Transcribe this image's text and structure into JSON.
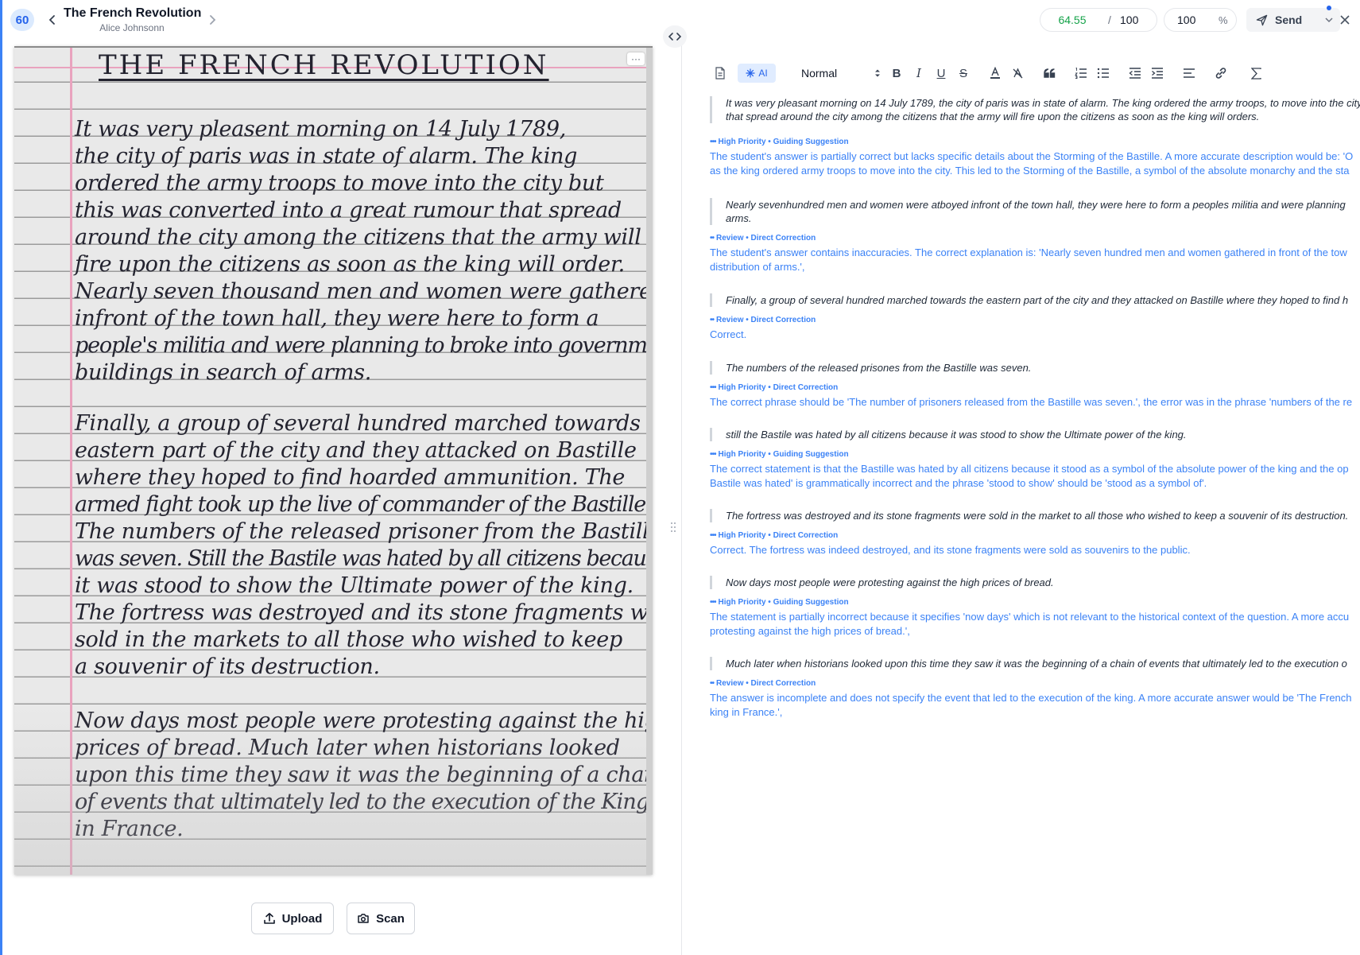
{
  "header": {
    "score_badge": "60",
    "title": "The French Revolution",
    "author": "Alice Johnsonn",
    "score_value": "64.55",
    "score_separator": "/",
    "score_max": "100",
    "percent_value": "100",
    "percent_sign": "%",
    "send_label": "Send"
  },
  "toolbar": {
    "ai_label": "AI",
    "text_style": "Normal"
  },
  "image_panel": {
    "title": "THE FRENCH REVOLUTION",
    "lines": [
      "It was very pleasent morning on 14 July 1789,",
      "the city of paris was in state of alarm. The king",
      "ordered the army troops to move into the city but",
      "this was converted into a great rumour that spread",
      "around the city among the citizens that the army will",
      "fire upon the citizens as soon as the king will order.",
      "Nearly seven thousand men and women were gathered",
      "infront of the town hall, they were here to form a",
      "people's militia and were planning to broke into government",
      "buildings in search of arms.",
      "Finally, a group of several hundred marched towards the",
      "eastern part of the city and they attacked on Bastille",
      "where they hoped to find hoarded ammunition. The",
      "armed fight took up the live of commander of the Bastille.",
      "The numbers of the released prisoner from the Bastille",
      "was seven. Still the Bastile was hated by all citizens because",
      "it was stood to show the Ultimate power of the king.",
      "The fortress was destroyed and its stone fragments were",
      "sold in the markets to all those who wished to keep",
      "a souvenir of its destruction.",
      "Now days most people were protesting against the high",
      "prices of bread. Much later when historians looked",
      "upon this time they saw it was the beginning of a chain",
      "of events that ultimately led to the execution of the King",
      "in France."
    ],
    "menu_label": "···",
    "upload_label": "Upload",
    "scan_label": "Scan"
  },
  "feedback": [
    {
      "quote": [
        "It was very pleasant morning on 14 July 1789, the city of paris was in state of alarm. The king ordered the army troops, to move into the city",
        "that spread around the city among the citizens that the army will fire upon the citizens as soon as the king will orders."
      ],
      "tag_dots": "•••",
      "tag": "High Priority • Guiding Suggestion",
      "feedback": [
        "The student's answer is partially correct but lacks specific details about the Storming of the Bastille. A more accurate description would be: 'O",
        "as the king ordered army troops to move into the city. This led to the Storming of the Bastille, a symbol of the absolute monarchy and the sta"
      ]
    },
    {
      "quote": [
        "Nearly sevenhundred men and women were atboyed infront of the town hall, they were here to form a peoples militia and were planning",
        "arms."
      ],
      "tag_dots": "••",
      "tag": "Review • Direct Correction",
      "feedback": [
        "The student's answer contains inaccuracies. The correct explanation is: 'Nearly seven hundred men and women gathered in front of the tow",
        "distribution of arms.',"
      ]
    },
    {
      "quote": [
        "Finally, a group of several hundred marched towards the eastern part of the city and they attacked on Bastille where they hoped to find h"
      ],
      "tag_dots": "••",
      "tag": "Review • Direct Correction",
      "feedback": [
        "Correct."
      ]
    },
    {
      "quote": [
        "The numbers of the released prisones from the Bastille was seven."
      ],
      "tag_dots": "•••",
      "tag": "High Priority • Direct Correction",
      "feedback": [
        "The correct phrase should be 'The number of prisoners released from the Bastille was seven.', the error was in the phrase 'numbers of the re"
      ]
    },
    {
      "quote": [
        "still the Bastile was hated by all citizens because it was stood to show the Ultimate power of the king."
      ],
      "tag_dots": "•••",
      "tag": "High Priority • Guiding Suggestion",
      "feedback": [
        "The correct statement is that the Bastille was hated by all citizens because it stood as a symbol of the absolute power of the king and the op",
        "Bastile was hated' is grammatically incorrect and the phrase 'stood to show' should be 'stood as a symbol of'."
      ]
    },
    {
      "quote": [
        "The fortress was destroyed and its stone fragments were sold in the market to all those who wished to keep a souvenir of its destruction."
      ],
      "tag_dots": "•••",
      "tag": "High Priority • Direct Correction",
      "feedback": [
        "Correct. The fortress was indeed destroyed, and its stone fragments were sold as souvenirs to the public."
      ]
    },
    {
      "quote": [
        "Now days most people were protesting against the high prices of bread."
      ],
      "tag_dots": "•••",
      "tag": "High Priority • Guiding Suggestion",
      "feedback": [
        "The statement is partially incorrect because it specifies 'now days' which is not relevant to the historical context of the question. A more accu",
        "protesting against the high prices of bread.',"
      ]
    },
    {
      "quote": [
        "Much later when historians looked upon this time they saw it was the beginning of a chain of events that ultimately led to the execution o"
      ],
      "tag_dots": "••",
      "tag": "Review • Direct Correction",
      "feedback": [
        "The answer is incomplete and does not specify the event that led to the execution of the king. A more accurate answer would be 'The French",
        "king in France.',"
      ]
    }
  ]
}
